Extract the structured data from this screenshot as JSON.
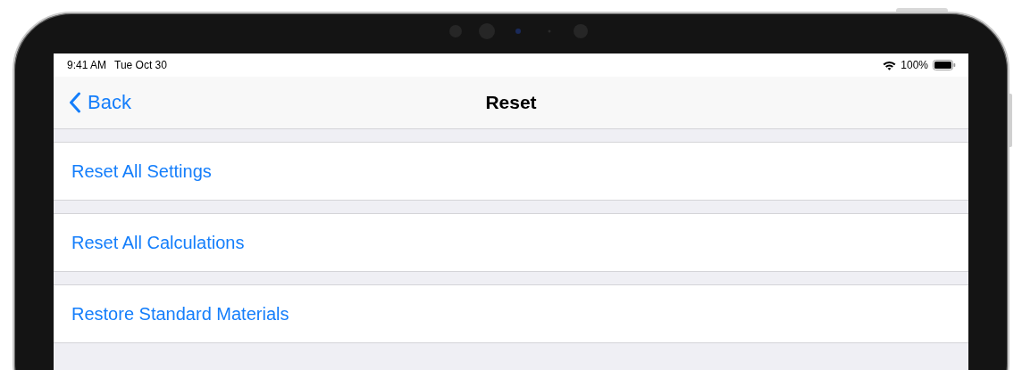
{
  "status_bar": {
    "time": "9:41 AM",
    "date": "Tue Oct 30",
    "battery": "100%"
  },
  "nav_bar": {
    "back": "Back",
    "title": "Reset"
  },
  "rows": [
    {
      "label": "Reset All Settings"
    },
    {
      "label": "Reset All Calculations"
    },
    {
      "label": "Restore Standard Materials"
    }
  ]
}
